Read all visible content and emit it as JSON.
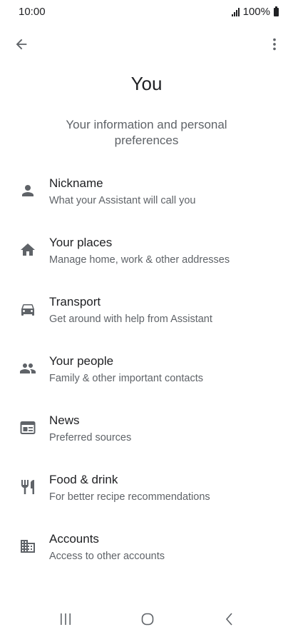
{
  "status_bar": {
    "time": "10:00",
    "battery_text": "100%"
  },
  "header": {
    "title": "You",
    "subtitle": "Your information and personal preferences"
  },
  "items": [
    {
      "icon": "person-icon",
      "title": "Nickname",
      "subtitle": "What your Assistant will call you"
    },
    {
      "icon": "home-icon",
      "title": "Your places",
      "subtitle": "Manage home, work & other addresses"
    },
    {
      "icon": "car-icon",
      "title": "Transport",
      "subtitle": "Get around with help from Assistant"
    },
    {
      "icon": "people-icon",
      "title": "Your people",
      "subtitle": "Family & other important contacts"
    },
    {
      "icon": "news-icon",
      "title": "News",
      "subtitle": "Preferred sources"
    },
    {
      "icon": "restaurant-icon",
      "title": "Food & drink",
      "subtitle": "For better recipe recommendations"
    },
    {
      "icon": "building-icon",
      "title": "Accounts",
      "subtitle": "Access to other accounts"
    }
  ],
  "colors": {
    "text_primary": "#202124",
    "text_secondary": "#5f6368",
    "icon": "#5f6368"
  }
}
